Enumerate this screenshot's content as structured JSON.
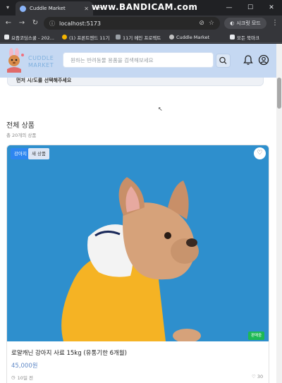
{
  "browser": {
    "tab_title": "Cuddle Market",
    "tab_close": "✕",
    "new_tab": "+",
    "watermark": "www.BANDICAM.com",
    "url": "localhost:5173",
    "secret_mode": "시크릿 모드",
    "bookmarks": [
      {
        "label": "요즘코딩스쿨 - 202..."
      },
      {
        "label": "(1) 프론트엔드 11기"
      },
      {
        "label": "11기 메인 프로젝트"
      },
      {
        "label": "Cuddle Market"
      }
    ],
    "all_bookmarks": "모든 북마크"
  },
  "site": {
    "logo_line1": "CUDDLE",
    "logo_line2": "MARKET",
    "search_placeholder": "원하는 반려동물 용품을 검색해보세요",
    "region_prompt": "먼저 시/도를 선택해주세요"
  },
  "section": {
    "title": "전체 상품",
    "count": "총 20개의 상품"
  },
  "product": {
    "category_badge": "강아지",
    "new_badge": "새 상품",
    "status_badge": "판매중",
    "title": "로얄캐닌 강아지 사료 15kg (유통기한 6개월)",
    "price": "45,000원",
    "posted": "10일 전",
    "likes": "30"
  },
  "colors": {
    "header_bg": "#c5d8f2",
    "accent_blue": "#2e86f0",
    "price_blue": "#5f88c6",
    "status_green": "#1db954",
    "photo_bg": "#2e8fcd"
  }
}
